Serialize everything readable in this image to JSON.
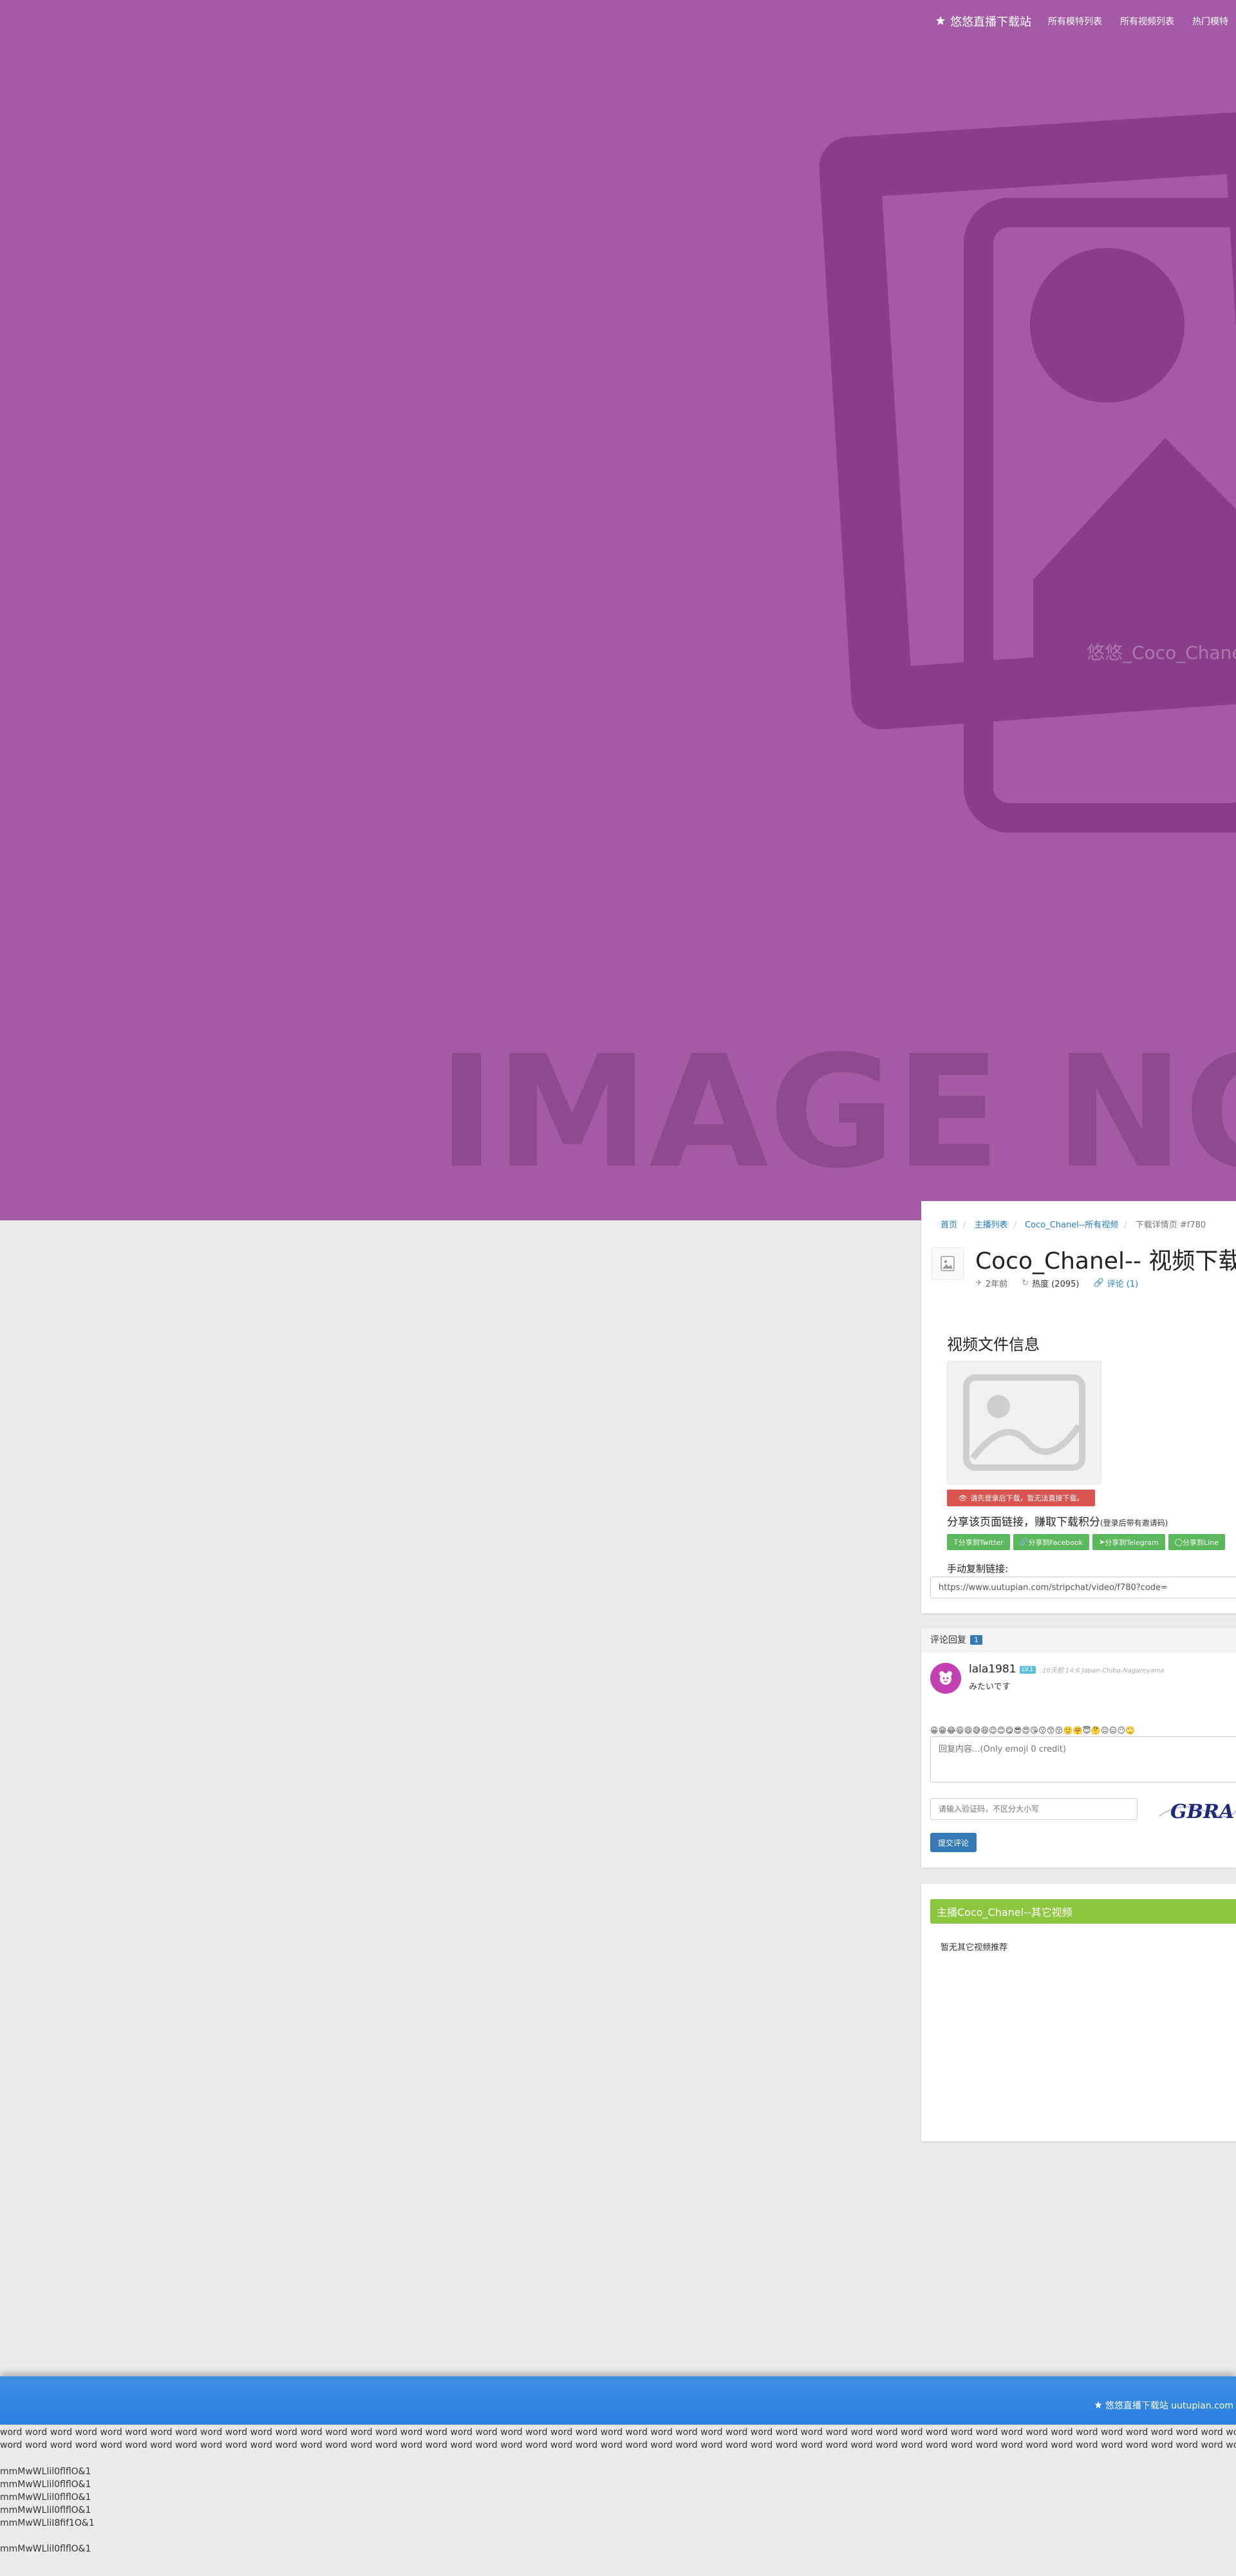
{
  "nav": {
    "brand": "悠悠直播下载站",
    "links": [
      "所有模特列表",
      "所有视频列表",
      "热门模特"
    ]
  },
  "hero": {
    "caption": "悠悠_Coco_Chanel",
    "image_text": "IMAGE NOT"
  },
  "breadcrumb": {
    "items": [
      "首页",
      "主播列表",
      "Coco_Chanel--所有视频"
    ],
    "current": "下载详情页 #f780"
  },
  "video": {
    "title": "Coco_Chanel-- 视频下载",
    "time_ago": "2年前",
    "hot": "热度 (2095)",
    "comments": "评论 (1)"
  },
  "file_info": {
    "heading": "视频文件信息",
    "login_notice": "请先登录后下载，暂无法直接下载。"
  },
  "share": {
    "prompt": "分享该页面链接，赚取下载积分",
    "note": "(登录后带有邀请码)",
    "buttons": [
      "分享到Twitter",
      "分享到Facebook",
      "分享到Telegram",
      "分享到Line"
    ],
    "copy_label": "手动复制链接:",
    "url": "https://www.uutupian.com/stripchat/video/f780?code="
  },
  "comments": {
    "header": "评论回复",
    "count": "1",
    "items": [
      {
        "user": "lala1981",
        "level": "LV.1",
        "time": "10天前 14:6 Japan-Chiba-Nagareyama",
        "text": "みたいです"
      }
    ],
    "emoji_bar": "😀😁😂😃😄😅😆😉😊😋😎😍😘😗😙😚🙂🤗😇🤔😐😑😶🙄",
    "reply_placeholder": "回复内容...(Only emoji 0 credit)",
    "captcha_placeholder": "请输入验证码，不区分大小写",
    "captcha_text": "GBRA",
    "submit": "提交评论"
  },
  "related": {
    "header": "主播Coco_Chanel--其它视频",
    "empty": "暂无其它视频推荐"
  },
  "footer": {
    "brand": "悠悠直播下载站 uutupian.com",
    "word_line": "word word word word word word word word word word word word word word word word word word word word word word word word word word word word word word word word word word word word word word word word word word word word word word word word word word word word word word word word word word word word word word word word word word word word word word word word word word word word word word word word word word word word word word word word word word word",
    "test_lines": [
      "mmMwWLlil0flflO&1",
      "mmMwWLlil0flflO&1",
      "mmMwWLlil0flflO&1",
      "mmMwWLlil0flflO&1",
      "mmMwWLliI8fif1O&1",
      "mmMwWLlil0flflO&1"
    ]
  },
  "colors": {
    "hero_bg": "#a55aa6",
    "accent_blue": "#337ab7",
    "share_green": "#5cb85c",
    "related_green": "#8dc63f",
    "login_red": "#d9534f",
    "footer_blue": "#2a7fe3"
  }
}
